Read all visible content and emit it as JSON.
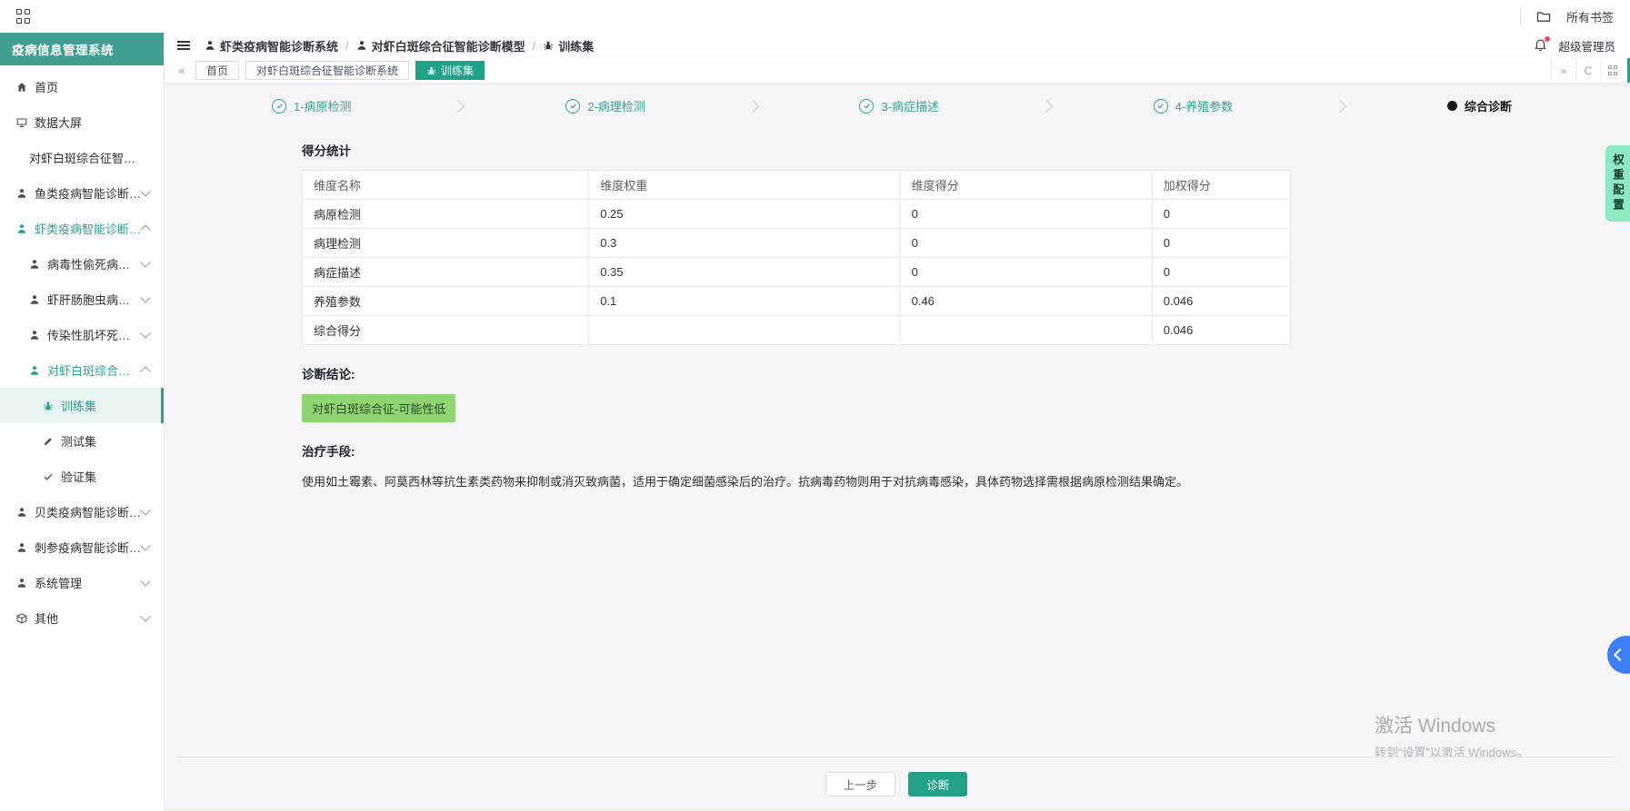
{
  "browser": {
    "bookmarks_label": "所有书签"
  },
  "sidebar": {
    "title": "疫病信息管理系统",
    "items": [
      {
        "label": "首页",
        "icon": "home",
        "level": 1
      },
      {
        "label": "数据大屏",
        "icon": "monitor",
        "level": 1
      },
      {
        "label": "对虾白斑综合征智能诊断系统",
        "icon": null,
        "level": 2
      },
      {
        "label": "鱼类疫病智能诊断系统",
        "icon": "user",
        "level": 1,
        "chevron": "down"
      },
      {
        "label": "虾类疫病智能诊断系统",
        "icon": "user",
        "level": 1,
        "chevron": "up",
        "highlight": true
      },
      {
        "label": "病毒性偷死病智能诊断模型",
        "icon": "user",
        "level": 2,
        "chevron": "down"
      },
      {
        "label": "虾肝肠胞虫病智能诊断模型",
        "icon": "user",
        "level": 2,
        "chevron": "down"
      },
      {
        "label": "传染性肌坏死智能诊断模型",
        "icon": "user",
        "level": 2,
        "chevron": "down"
      },
      {
        "label": "对虾白斑综合征智能诊断模型",
        "icon": "user",
        "level": 2,
        "chevron": "up",
        "highlight": true
      },
      {
        "label": "训练集",
        "icon": "bug",
        "level": 3,
        "active": true
      },
      {
        "label": "测试集",
        "icon": "pencil",
        "level": 3
      },
      {
        "label": "验证集",
        "icon": "check",
        "level": 3
      },
      {
        "label": "贝类疫病智能诊断系统",
        "icon": "user",
        "level": 1,
        "chevron": "down"
      },
      {
        "label": "刺参疫病智能诊断系统",
        "icon": "user",
        "level": 1,
        "chevron": "down"
      },
      {
        "label": "系统管理",
        "icon": "user",
        "level": 1,
        "chevron": "down"
      },
      {
        "label": "其他",
        "icon": "box",
        "level": 1,
        "chevron": "down"
      }
    ]
  },
  "header": {
    "breadcrumb": [
      {
        "label": "虾类疫病智能诊断系统",
        "icon": "user"
      },
      {
        "label": "对虾白斑综合征智能诊断模型",
        "icon": "user"
      },
      {
        "label": "训练集",
        "icon": "bug"
      }
    ],
    "user": "超级管理员"
  },
  "tabs": [
    {
      "label": "首页"
    },
    {
      "label": "对虾白斑综合征智能诊断系统"
    },
    {
      "label": "训练集",
      "icon": "bug",
      "active": true
    }
  ],
  "stepper": [
    {
      "label": "1-病原检测",
      "state": "done"
    },
    {
      "label": "2-病理检测",
      "state": "done"
    },
    {
      "label": "3-病症描述",
      "state": "done"
    },
    {
      "label": "4-养殖参数",
      "state": "done"
    },
    {
      "label": "综合诊断",
      "state": "current"
    }
  ],
  "score": {
    "title": "得分统计",
    "columns": [
      "维度名称",
      "维度权重",
      "维度得分",
      "加权得分"
    ],
    "rows": [
      [
        "病原检测",
        "0.25",
        "0",
        "0"
      ],
      [
        "病理检测",
        "0.3",
        "0",
        "0"
      ],
      [
        "病症描述",
        "0.35",
        "0",
        "0"
      ],
      [
        "养殖参数",
        "0.1",
        "0.46",
        "0.046"
      ],
      [
        "综合得分",
        "",
        "",
        "0.046"
      ]
    ]
  },
  "diagnosis": {
    "conclusion_label": "诊断结论:",
    "conclusion": "对虾白斑综合征-可能性低",
    "treatment_label": "治疗手段:",
    "treatment": "使用如土霉素、阿莫西林等抗生素类药物来抑制或消灭致病菌，适用于确定细菌感染后的治疗。抗病毒药物则用于对抗病毒感染，具体药物选择需根据病原检测结果确定。"
  },
  "footer": {
    "prev_label": "上一步",
    "diagnose_label": "诊断"
  },
  "right_tag": "权重配置",
  "watermark": {
    "line1": "激活 Windows",
    "line2": "转到“设置”以激活 Windows。"
  },
  "colors": {
    "accent": "#2f9e8d",
    "tab_active": "#21a185",
    "badge_bg": "#8fd672",
    "tag_bg": "#8ce9c4",
    "float_btn": "#3e7ef7",
    "sidebar_header": "#3f9f90"
  }
}
